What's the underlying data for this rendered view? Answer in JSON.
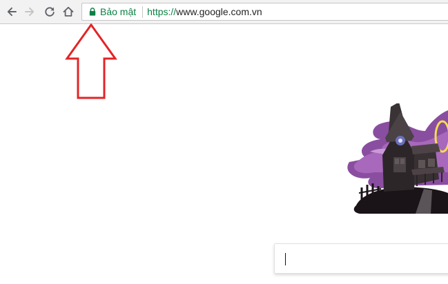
{
  "toolbar": {
    "back_icon": "arrow-left-icon",
    "forward_icon": "arrow-right-icon",
    "reload_icon": "reload-icon",
    "home_icon": "home-icon"
  },
  "omnibox": {
    "lock_icon": "lock-icon",
    "secure_label": "Bảo mật",
    "url_scheme": "https://",
    "url_host": "www.google.com.vn",
    "secure_color": "#0b8043"
  },
  "annotation": {
    "arrow_color": "#e32426",
    "arrow_icon": "up-arrow-outline"
  },
  "doodle": {
    "subject": "haunted-house-doodle",
    "sky_color": "#8a4ea0"
  },
  "search": {
    "value": ""
  }
}
